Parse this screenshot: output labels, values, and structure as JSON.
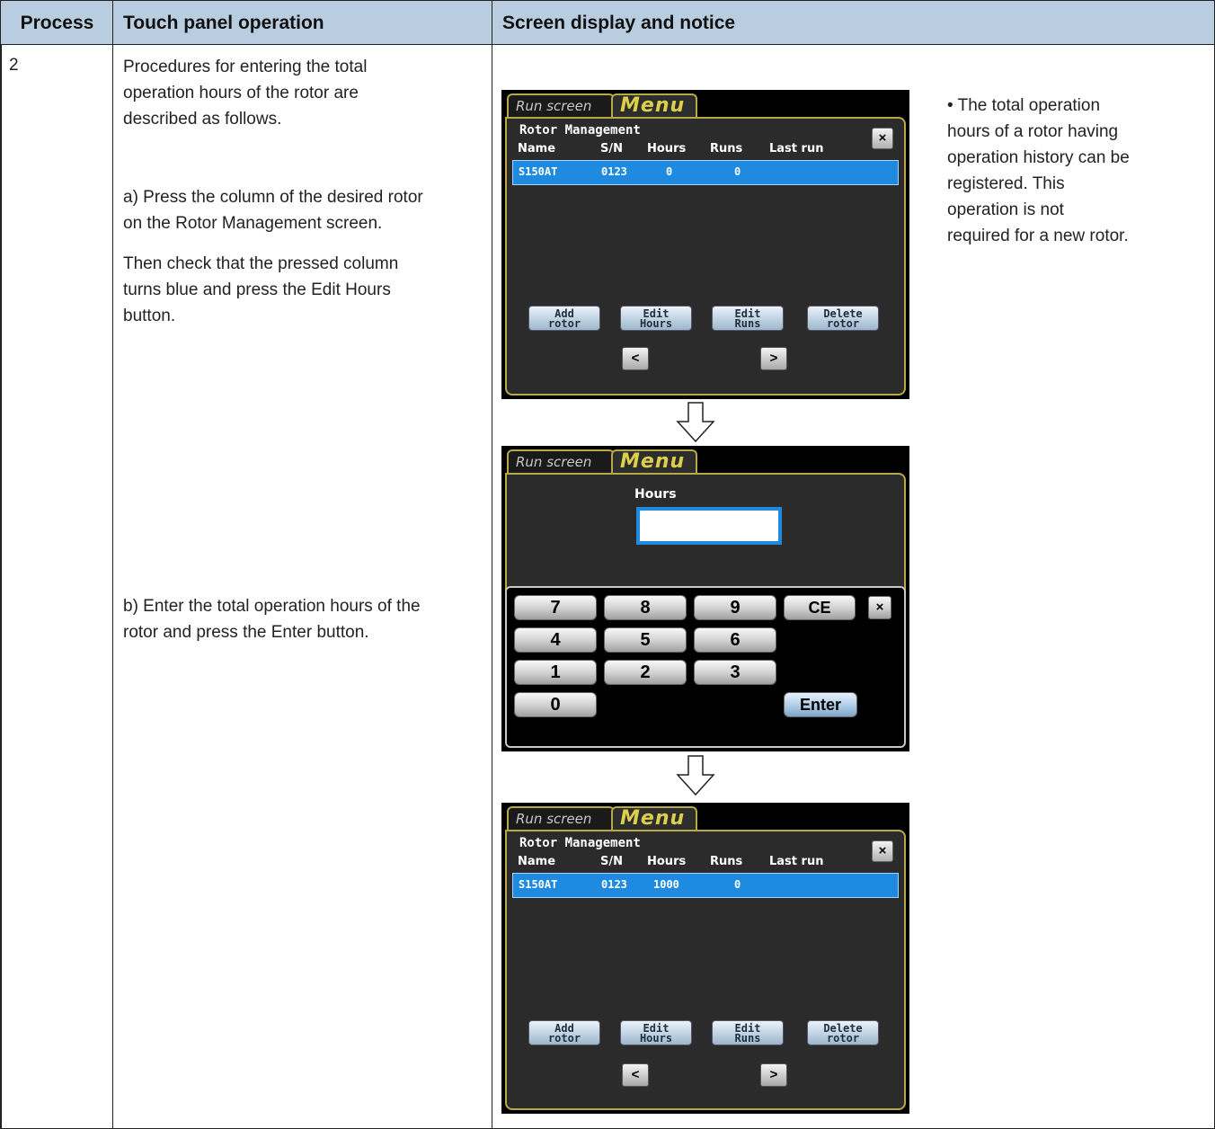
{
  "table": {
    "headers": [
      "Process",
      "Touch panel operation",
      "Screen display and notice"
    ],
    "process_number": "2",
    "intro_lines": [
      "Procedures for entering the total",
      "operation hours of the rotor are",
      "described as follows."
    ],
    "step_a_lines": [
      "a) Press the column of the desired rotor",
      "on the Rotor Management screen."
    ],
    "step_a2_lines": [
      "Then check that the pressed column",
      "turns blue and press the Edit Hours",
      "button."
    ],
    "step_b_lines": [
      "b) Enter the total operation hours of the",
      "rotor and press the Enter button."
    ],
    "notice_lines": [
      "• The total operation",
      "hours of a rotor having",
      "operation history can be",
      "registered. This",
      "operation is not",
      "required for a new rotor."
    ]
  },
  "screen_common": {
    "tab_run": "Run screen",
    "tab_menu": "Menu",
    "close_label": "×",
    "prev_label": "<",
    "next_label": ">"
  },
  "rotor_screen": {
    "title": "Rotor Management",
    "columns": [
      "Name",
      "S/N",
      "Hours",
      "Runs",
      "Last run"
    ],
    "buttons": [
      {
        "line1": "Add",
        "line2": "rotor"
      },
      {
        "line1": "Edit",
        "line2": "Hours"
      },
      {
        "line1": "Edit",
        "line2": "Runs"
      },
      {
        "line1": "Delete",
        "line2": "rotor"
      }
    ]
  },
  "screen1_row": {
    "name": "S150AT",
    "sn": "0123",
    "hours": "0",
    "runs": "0"
  },
  "screen3_row": {
    "name": "S150AT",
    "sn": "0123",
    "hours": "1000",
    "runs": "0"
  },
  "keypad_screen": {
    "field_label": "Hours",
    "keys": [
      "7",
      "8",
      "9",
      "CE",
      "4",
      "5",
      "6",
      "1",
      "2",
      "3",
      "0"
    ],
    "enter_label": "Enter",
    "close_label": "×"
  },
  "colors": {
    "header_bg": "#b9cde0",
    "selected_row": "#1f8be0",
    "panel_border": "#b8a84a",
    "menu_tab_text": "#dcd04a"
  },
  "icons": [
    "close-icon",
    "chevron-left-icon",
    "chevron-right-icon",
    "down-arrow-icon"
  ]
}
